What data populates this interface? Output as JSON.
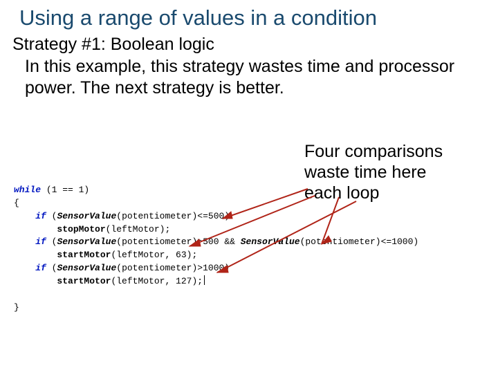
{
  "title": "Using a range of values in a condition",
  "subhead": "Strategy #1: Boolean logic",
  "body": "In this example, this strategy wastes time and processor power. The next strategy is better.",
  "callout": {
    "line1": "Four comparisons",
    "line2": "waste time here",
    "line3": "each loop"
  },
  "code": {
    "while_kw": "while",
    "while_cond": " (1 == 1)",
    "open_brace": "{",
    "if_kw": "if",
    "sensor": "SensorValue",
    "pot": "(potentiometer)",
    "cmp1": "<=500)",
    "stop": "stopMotor",
    "stop_args": "(leftMotor);",
    "cmp2a": ">500",
    "and": " && ",
    "cmp2b": "<=1000)",
    "start1": "startMotor",
    "start1_args": "(leftMotor, 63);",
    "cmp3": ">1000)",
    "start2": "startMotor",
    "start2_args": "(leftMotor, 127);",
    "close_brace": "}"
  }
}
